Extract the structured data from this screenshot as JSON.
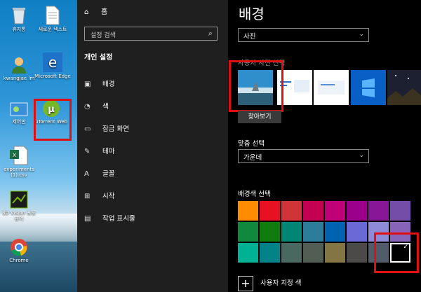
{
  "desktop": {
    "icons": [
      {
        "label": "휴지통"
      },
      {
        "label": "새로운 텍스트"
      },
      {
        "label": "kwangjae lm"
      },
      {
        "label": "Microsoft Edge"
      },
      {
        "label": "제어판"
      },
      {
        "label": "uTorrent Web"
      },
      {
        "label": "experiments (1).csv"
      },
      {
        "label": "3D Vision 포토 뷰어"
      },
      {
        "label": "Chrome"
      }
    ]
  },
  "nav": {
    "home_label": "홈",
    "search_placeholder": "설정 검색",
    "section_title": "개인 설정",
    "items": [
      {
        "label": "배경",
        "icon": "image-icon"
      },
      {
        "label": "색",
        "icon": "palette-icon"
      },
      {
        "label": "잠금 화면",
        "icon": "lock-screen-icon"
      },
      {
        "label": "테마",
        "icon": "theme-icon"
      },
      {
        "label": "글꼴",
        "icon": "font-icon"
      },
      {
        "label": "시작",
        "icon": "start-icon"
      },
      {
        "label": "작업 표시줄",
        "icon": "taskbar-icon"
      }
    ]
  },
  "main": {
    "title": "배경",
    "background_type": {
      "value": "사진"
    },
    "choose_picture_label": "사용자 사진 선택",
    "browse_button": "찾아보기",
    "fit": {
      "label": "맞춤 선택",
      "value": "가운데"
    },
    "color_label": "배경색 선택",
    "custom_color_label": "사용자 지정 색",
    "swatches": [
      [
        "#ff8c00",
        "#e81123",
        "#d13438",
        "#c30052",
        "#bf0077",
        "#9a0089",
        "#881798",
        "#744da9"
      ],
      [
        "#10893e",
        "#107c10",
        "#018574",
        "#2d7d9a",
        "#0063b1",
        "#6b69d6",
        "#8e8cd8",
        "#8764b8"
      ],
      [
        "#00b294",
        "#038387",
        "#486860",
        "#525e54",
        "#847545",
        "#4c4a48",
        "#515c6b",
        "#000000"
      ]
    ]
  }
}
